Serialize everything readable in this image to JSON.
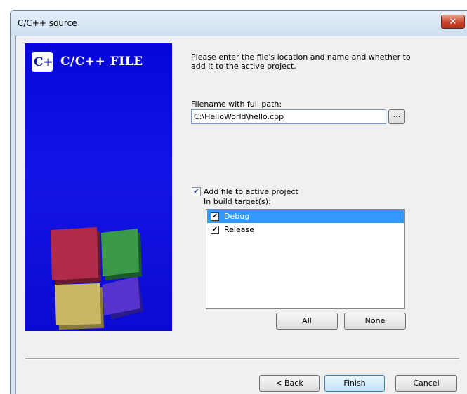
{
  "window": {
    "title": "C/C++ source",
    "close_glyph": "✕"
  },
  "banner": {
    "logo_glyph": "C++",
    "logo_title": "C/C++ FILE"
  },
  "description": "Please enter the file's location and name and whether to add it to the active project.",
  "filename": {
    "label": "Filename with full path:",
    "value": "C:\\HelloWorld\\hello.cpp",
    "browse_label": "..."
  },
  "add_to_project": {
    "label": "Add file to active project",
    "checked": true
  },
  "build_targets": {
    "label": "In build target(s):",
    "items": [
      {
        "label": "Debug",
        "checked": true,
        "selected": true
      },
      {
        "label": "Release",
        "checked": true,
        "selected": false
      }
    ],
    "all_label": "All",
    "none_label": "None"
  },
  "footer": {
    "back_label": "< Back",
    "finish_label": "Finish",
    "cancel_label": "Cancel"
  },
  "colors": {
    "banner": "#0b0bdc",
    "selection": "#3399ff"
  }
}
